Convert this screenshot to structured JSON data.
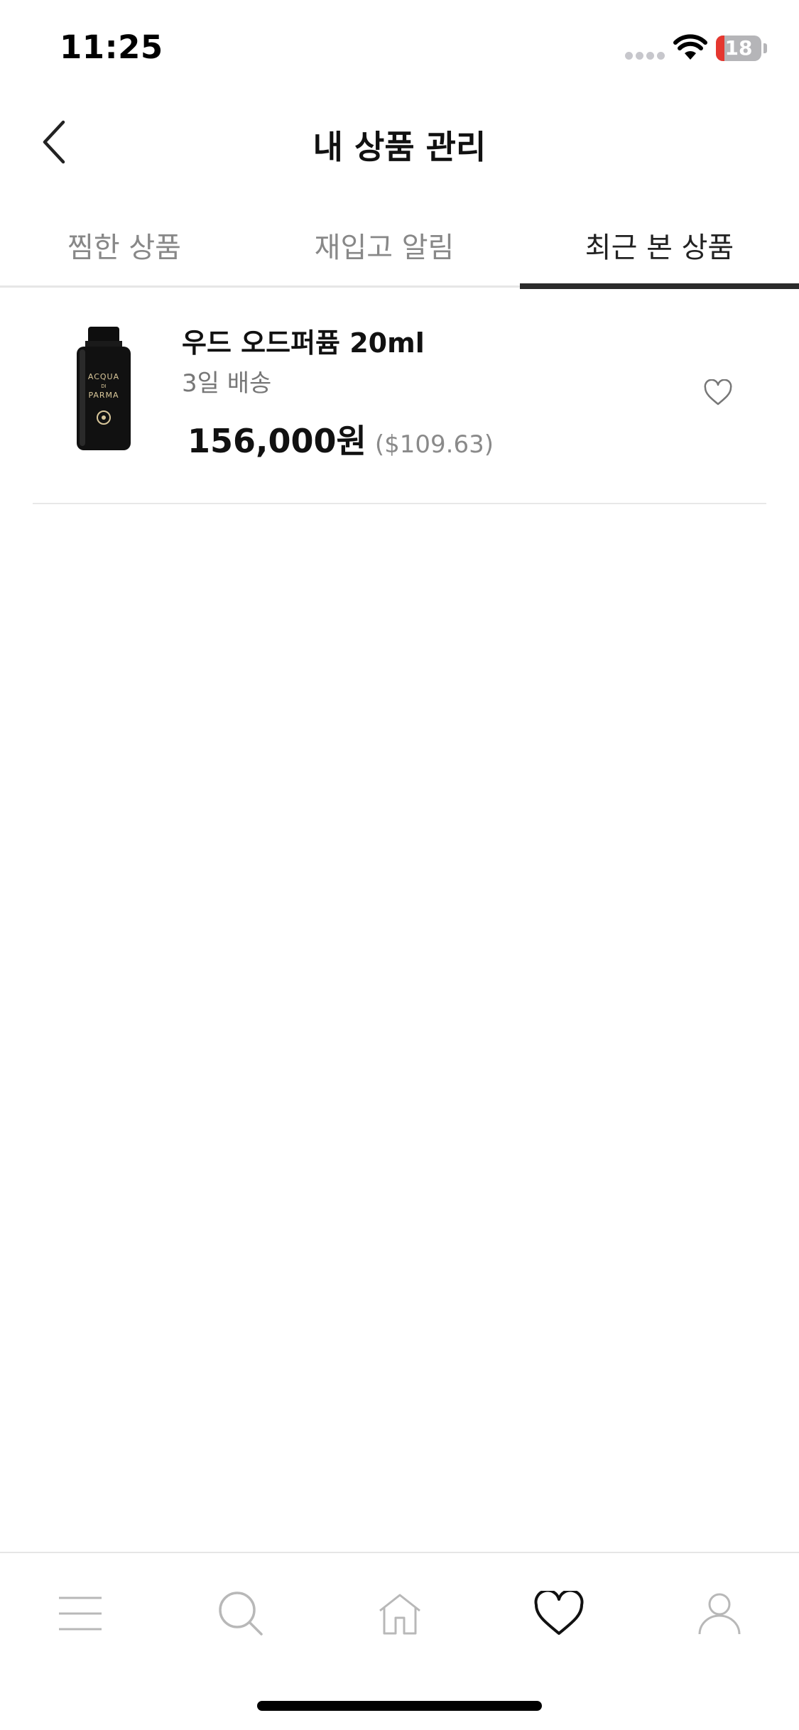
{
  "status_bar": {
    "time": "11:25",
    "battery_level": "18",
    "battery_fraction": 0.18,
    "battery_color": "#e5372f"
  },
  "header": {
    "title": "내 상품 관리",
    "back_icon": "chevron-left-icon"
  },
  "tabs": [
    {
      "label": "찜한 상품",
      "active": false
    },
    {
      "label": "재입고 알림",
      "active": false
    },
    {
      "label": "최근 본 상품",
      "active": true
    }
  ],
  "products": [
    {
      "name": "우드 오드퍼퓸 20ml",
      "shipping": "3일 배송",
      "price": "156,000원",
      "price_usd": "($109.63)",
      "image_icon": "perfume-bottle-image",
      "brand_label": "ACQUA DI PARMA",
      "wish_icon": "heart-outline-icon"
    }
  ],
  "bottom_nav": [
    {
      "name": "menu",
      "icon": "menu-icon",
      "active": false
    },
    {
      "name": "search",
      "icon": "search-icon",
      "active": false
    },
    {
      "name": "home",
      "icon": "home-icon",
      "active": false
    },
    {
      "name": "wishlist",
      "icon": "heart-icon",
      "active": true
    },
    {
      "name": "my-page",
      "icon": "user-icon",
      "active": false
    }
  ],
  "colors": {
    "active_text": "#222222",
    "inactive_text": "#888888",
    "nav_inactive": "#b8b8b8",
    "nav_active": "#111111"
  }
}
